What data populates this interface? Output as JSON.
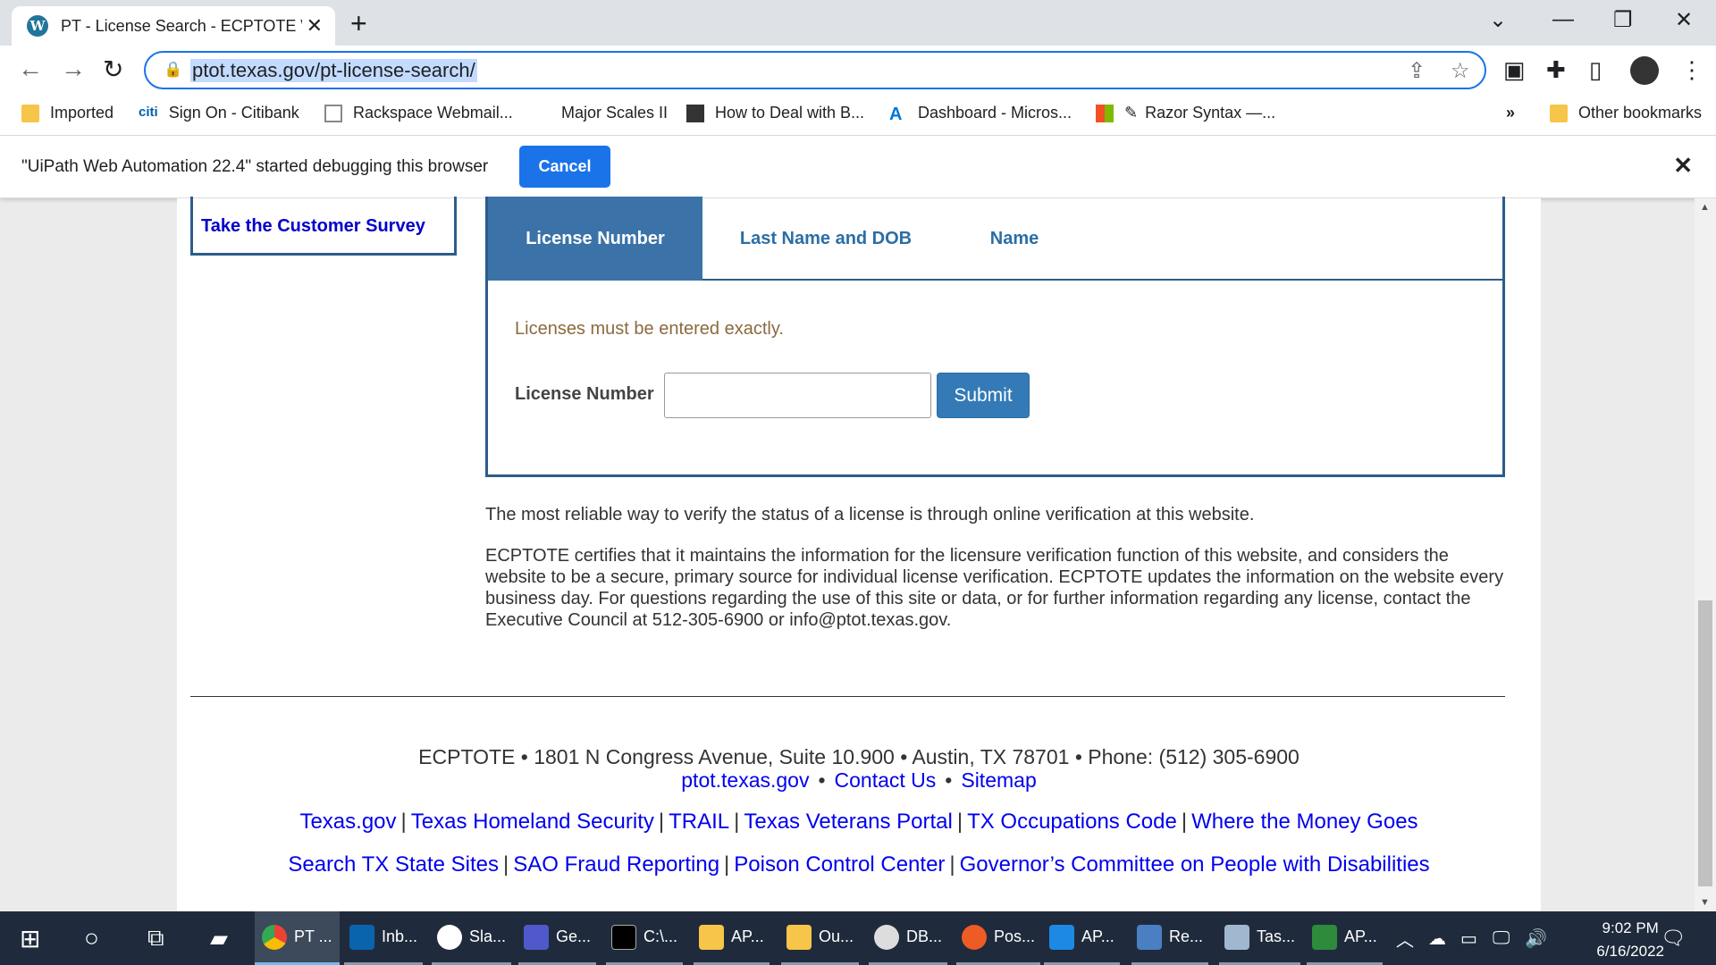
{
  "browser": {
    "tab_title": "PT - License Search - ECPTOTE W",
    "url": "ptot.texas.gov/pt-license-search/",
    "bookmarks": [
      {
        "label": "Imported"
      },
      {
        "label": "Sign On - Citibank"
      },
      {
        "label": "Rackspace Webmail..."
      },
      {
        "label": "Major Scales II"
      },
      {
        "label": "How to Deal with B..."
      },
      {
        "label": "Dashboard - Micros..."
      },
      {
        "label": "Razor Syntax —..."
      },
      {
        "label": "»"
      },
      {
        "label": "Other bookmarks"
      }
    ],
    "infobar_text": "\"UiPath Web Automation 22.4\" started debugging this browser",
    "infobar_cancel": "Cancel"
  },
  "page": {
    "survey_link": "Take the Customer Survey",
    "search_tabs": [
      {
        "label": "License Number",
        "active": true
      },
      {
        "label": "Last Name and DOB",
        "active": false
      },
      {
        "label": "Name",
        "active": false
      }
    ],
    "note": "Licenses must be entered exactly.",
    "license_label": "License Number",
    "license_value": "",
    "submit_label": "Submit",
    "para1": "The most reliable way to verify the status of a license is through online verification at this website.",
    "para2": "ECPTOTE certifies that it maintains the information for the licensure verification function of this website, and considers the website to be a secure, primary source for individual license verification. ECPTOTE updates the information on the website every business day. For questions regarding the use of this site or data, or for further information regarding any license, contact the Executive Council at 512-305-6900 or info@ptot.texas.gov."
  },
  "footer": {
    "address": "ECPTOTE • 1801 N Congress Avenue, Suite 10.900 • Austin, TX 78701 • Phone: (512) 305-6900",
    "links_row1": [
      "ptot.texas.gov",
      "Contact Us",
      "Sitemap"
    ],
    "links_row2": [
      "Texas.gov",
      "Texas Homeland Security",
      "TRAIL",
      "Texas Veterans Portal",
      "TX Occupations Code",
      "Where the Money Goes"
    ],
    "links_row3": [
      "Search TX State Sites",
      "SAO Fraud Reporting",
      "Poison Control Center",
      "Governor’s Committee on People with Disabilities"
    ]
  },
  "taskbar": {
    "items": [
      "PT ...",
      "Inb...",
      "Sla...",
      "Ge...",
      "C:\\...",
      "AP...",
      "Ou...",
      "DB...",
      "Pos...",
      "AP...",
      "Re...",
      "Tas...",
      "AP..."
    ],
    "time": "9:02 PM",
    "date": "6/16/2022"
  },
  "colors": {
    "primary_blue": "#3b73a9",
    "link_blue": "#0000ee",
    "chrome_accent": "#1a73e8"
  }
}
